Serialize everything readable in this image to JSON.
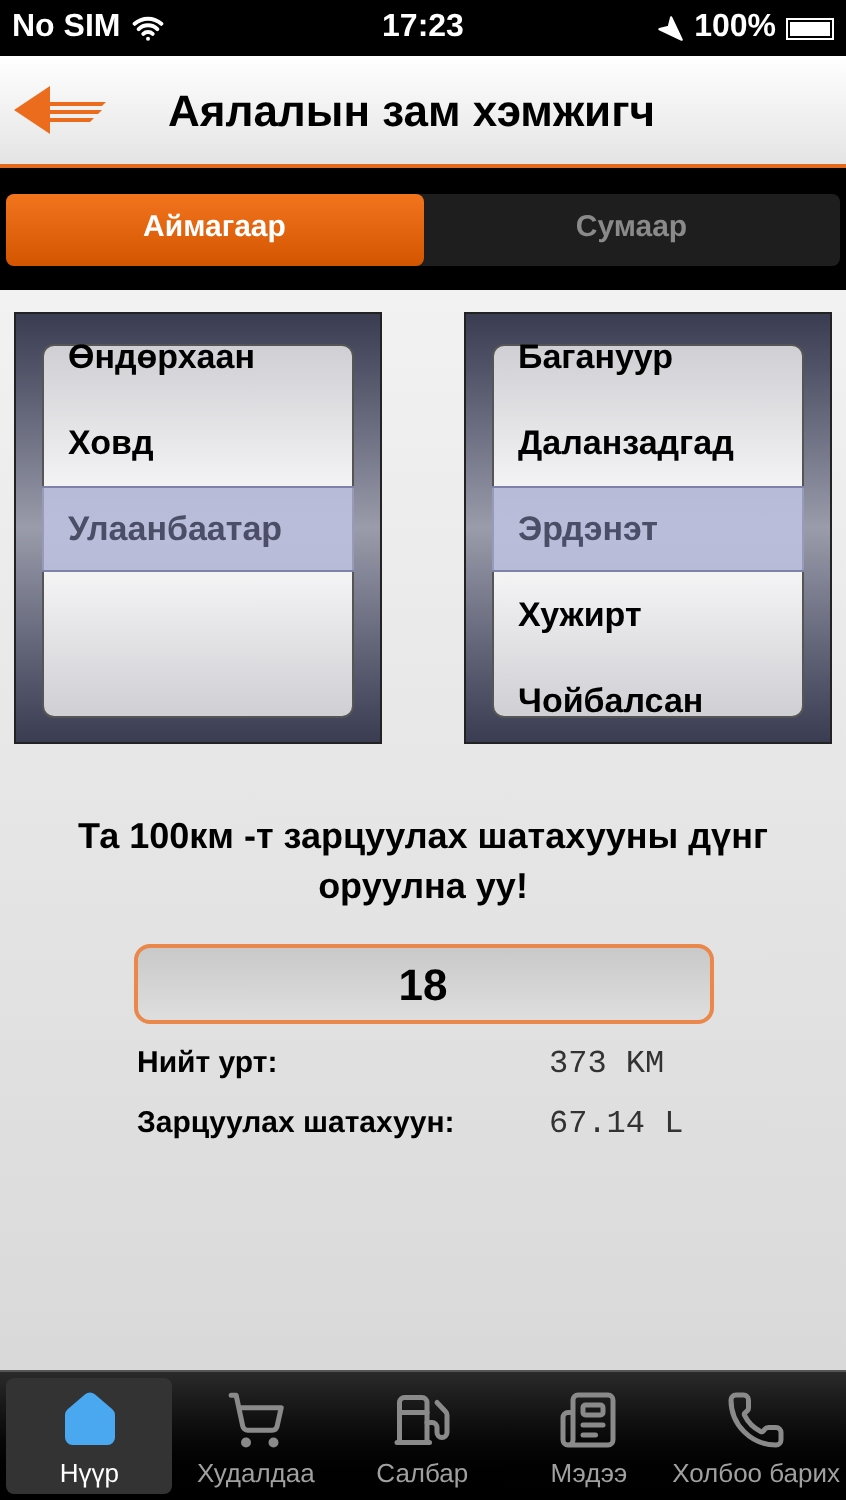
{
  "status_bar": {
    "carrier": "No SIM",
    "time": "17:23",
    "battery": "100%"
  },
  "nav": {
    "title": "Аялалын зам хэмжигч"
  },
  "segments": [
    {
      "label": "Аймагаар",
      "selected": true
    },
    {
      "label": "Сумаар",
      "selected": false
    }
  ],
  "pickers": [
    {
      "items": [
        {
          "label": "Өндөрхаан",
          "selected": false
        },
        {
          "label": "Ховд",
          "selected": false
        },
        {
          "label": "Улаанбаатар",
          "selected": true
        }
      ]
    },
    {
      "items": [
        {
          "label": "Багануур",
          "selected": false
        },
        {
          "label": "Даланзадгад",
          "selected": false
        },
        {
          "label": "Эрдэнэт",
          "selected": true
        },
        {
          "label": "Хужирт",
          "selected": false
        },
        {
          "label": "Чойбалсан",
          "selected": false
        }
      ]
    }
  ],
  "prompt": "Та 100км -т зарцуулах шатахууны дүнг оруулна уу!",
  "fuel_input": {
    "value": "18"
  },
  "results": [
    {
      "label": "Нийт урт:",
      "value": "373 KM"
    },
    {
      "label": "Зарцуулах шатахуун:",
      "value": "67.14 L"
    }
  ],
  "tab_bar": [
    {
      "label": "Нүүр",
      "kind": "home",
      "selected": true
    },
    {
      "label": "Худалдаа",
      "kind": "cart",
      "selected": false
    },
    {
      "label": "Салбар",
      "kind": "fuel",
      "selected": false
    },
    {
      "label": "Мэдээ",
      "kind": "news",
      "selected": false
    },
    {
      "label": "Холбоо барих",
      "kind": "phone",
      "selected": false
    }
  ]
}
